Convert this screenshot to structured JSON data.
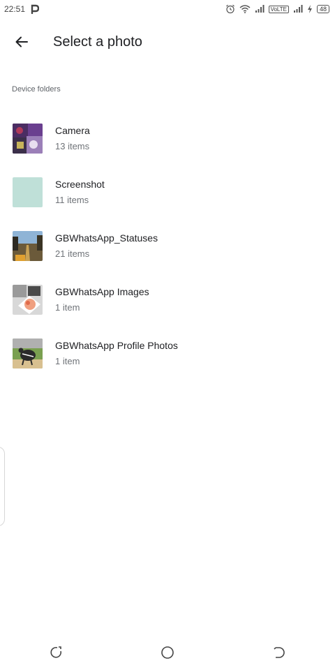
{
  "status_bar": {
    "time": "22:51",
    "left_icon": "p-app-icon",
    "icons": [
      "alarm-icon",
      "wifi-icon",
      "signal-icon",
      "volte-badge",
      "signal-icon",
      "charging-icon",
      "battery-icon"
    ],
    "volte_label": "VoLTE",
    "battery_level": "48"
  },
  "header": {
    "back_icon": "arrow-back-icon",
    "title": "Select a photo"
  },
  "section": {
    "label": "Device folders"
  },
  "folders": [
    {
      "name": "Camera",
      "count": "13 items",
      "thumb_colors": [
        "#3a2a4a",
        "#6b3f8a",
        "#b79fce",
        "#2c3e50"
      ]
    },
    {
      "name": "Screenshot",
      "count": "11 items",
      "thumb_colors": [
        "#bfe0d8"
      ]
    },
    {
      "name": "GBWhatsApp_Statuses",
      "count": "21 items",
      "thumb_colors": [
        "#8fb4d6",
        "#6b5a3a",
        "#c9a255",
        "#2e2a22"
      ]
    },
    {
      "name": "GBWhatsApp Images",
      "count": "1 item",
      "thumb_colors": [
        "#d8d8d8",
        "#f0a080",
        "#4a4a4a",
        "#ffffff"
      ]
    },
    {
      "name": "GBWhatsApp Profile Photos",
      "count": "1 item",
      "thumb_colors": [
        "#7aa050",
        "#2a2a2a",
        "#d8c090",
        "#b0b0b0"
      ]
    }
  ],
  "nav_bar": {
    "icons": [
      "recents-icon",
      "home-icon",
      "back-nav-icon"
    ]
  },
  "colors": {
    "primary_text": "#202124",
    "secondary_text": "#6f7378",
    "background": "#ffffff"
  }
}
